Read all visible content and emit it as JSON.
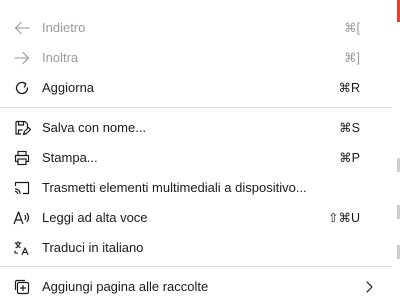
{
  "menu": {
    "items": [
      {
        "label": "Indietro",
        "shortcut": "⌘[",
        "icon": "arrow-left-icon",
        "enabled": false
      },
      {
        "label": "Inoltra",
        "shortcut": "⌘]",
        "icon": "arrow-right-icon",
        "enabled": false
      },
      {
        "label": "Aggiorna",
        "shortcut": "⌘R",
        "icon": "refresh-icon",
        "enabled": true
      },
      {
        "label": "Salva con nome...",
        "shortcut": "⌘S",
        "icon": "save-as-icon",
        "enabled": true
      },
      {
        "label": "Stampa...",
        "shortcut": "⌘P",
        "icon": "print-icon",
        "enabled": true
      },
      {
        "label": "Trasmetti elementi multimediali a dispositivo...",
        "shortcut": "",
        "icon": "cast-icon",
        "enabled": true
      },
      {
        "label": "Leggi ad alta voce",
        "shortcut": "⇧⌘U",
        "icon": "read-aloud-icon",
        "enabled": true
      },
      {
        "label": "Traduci in italiano",
        "shortcut": "",
        "icon": "translate-icon",
        "enabled": true
      },
      {
        "label": "Aggiungi pagina alle raccolte",
        "shortcut": "",
        "icon": "collections-add-icon",
        "enabled": true,
        "submenu": true
      }
    ]
  },
  "colors": {
    "text": "#1b1b1b",
    "disabled": "#9a9a9a",
    "separator": "#e2e2e2",
    "accent_edge": "#d8453a"
  }
}
